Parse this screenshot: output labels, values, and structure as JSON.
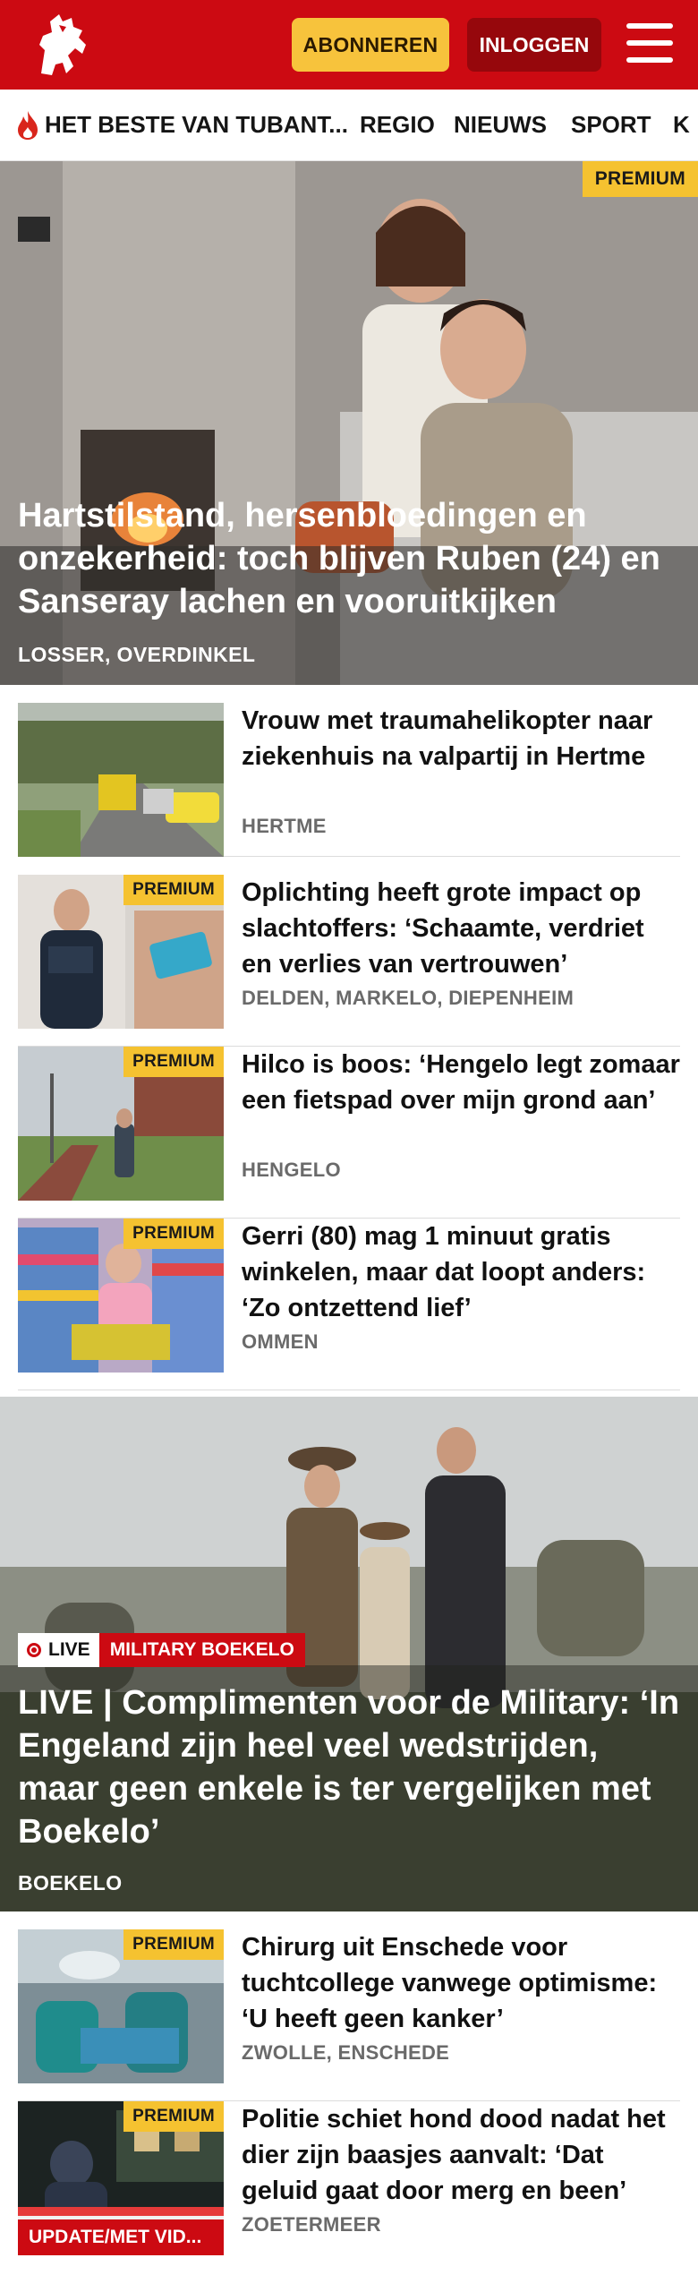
{
  "header": {
    "subscribe_label": "ABONNEREN",
    "login_label": "INLOGGEN",
    "brand_color": "#cc0a12",
    "logo_icon": "horse-logo-icon",
    "menu_icon": "hamburger-menu-icon"
  },
  "nav": {
    "items": [
      {
        "label": "HET BESTE VAN TUBANT..."
      },
      {
        "label": "REGIO"
      },
      {
        "label": "NIEUWS"
      },
      {
        "label": "SPORT"
      },
      {
        "label": "K"
      }
    ]
  },
  "hero": {
    "badge": "PREMIUM",
    "title": "Hartstilstand, hersenbloedingen en onzekerheid: toch blijven Ruben (24) en Sanseray lachen en vooruitkijken",
    "location": "LOSSER, OVERDINKEL"
  },
  "articles": [
    {
      "title": "Vrouw met traumahelikopter naar ziekenhuis na valpartij in Hertme",
      "location": "HERTME",
      "badge": ""
    },
    {
      "title": "Oplichting heeft grote impact op slachtoffers: ‘Schaamte, verdriet en verlies van vertrouwen’",
      "location": "DELDEN, MARKELO, DIEPENHEIM",
      "badge": "PREMIUM"
    },
    {
      "title": "Hilco is boos: ‘Hengelo legt zomaar een fietspad over mijn grond aan’",
      "location": "HENGELO",
      "badge": "PREMIUM"
    },
    {
      "title": "Gerri (80) mag 1 minuut gratis winkelen, maar dat loopt anders: ‘Zo ontzettend lief’",
      "location": "OMMEN",
      "badge": "PREMIUM"
    }
  ],
  "live": {
    "live_label": "LIVE",
    "category": "MILITARY BOEKELO",
    "title": "LIVE | Complimenten voor de Military: ‘In Engeland zijn heel veel wedstrij­den, maar geen enkele is ter vergelij­ken met Boekelo’",
    "location": "BOEKELO"
  },
  "articles2": [
    {
      "title": "Chirurg uit Enschede voor tuchtcollege vanwege optimisme: ‘U heeft geen kanker’",
      "location": "ZWOLLE, ENSCHEDE",
      "badge": "PREMIUM"
    },
    {
      "title": "Politie schiet hond dood nadat het dier zijn baasjes aanvalt: ‘Dat geluid gaat door merg en been’",
      "location": "ZOETERMEER",
      "badge": "PREMIUM",
      "update_label": "UPDATE/MET VID..."
    }
  ]
}
